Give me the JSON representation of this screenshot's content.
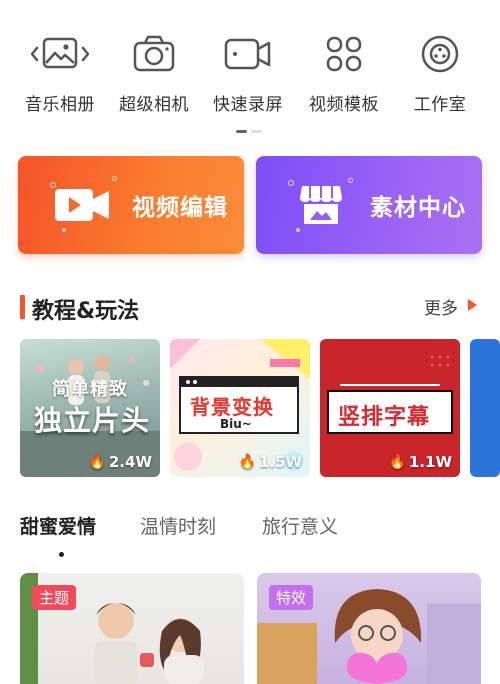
{
  "tools": [
    {
      "label": "音乐相册",
      "icon": "music-album-icon"
    },
    {
      "label": "超级相机",
      "icon": "camera-icon"
    },
    {
      "label": "快速录屏",
      "icon": "screen-record-icon"
    },
    {
      "label": "视频模板",
      "icon": "template-grid-icon"
    },
    {
      "label": "工作室",
      "icon": "studio-icon"
    }
  ],
  "features": {
    "edit_label": "视频编辑",
    "material_label": "素材中心"
  },
  "section": {
    "title": "教程&玩法",
    "more": "更多"
  },
  "tutorials": [
    {
      "overlay_text_1": "简单精致",
      "overlay_text_2": "独立片头",
      "count": "2.4W"
    },
    {
      "overlay_text_1": "背景变换",
      "overlay_text_2": "Biu~",
      "count": "1.5W"
    },
    {
      "overlay_text_1": "竖排字幕",
      "count": "1.1W"
    }
  ],
  "tabs": [
    "甜蜜爱情",
    "温情时刻",
    "旅行意义"
  ],
  "bottom_cards": [
    {
      "badge": "主题"
    },
    {
      "badge": "特效"
    }
  ],
  "colors": {
    "accent_orange": "#f4552c",
    "accent_purple": "#8a58f6"
  }
}
